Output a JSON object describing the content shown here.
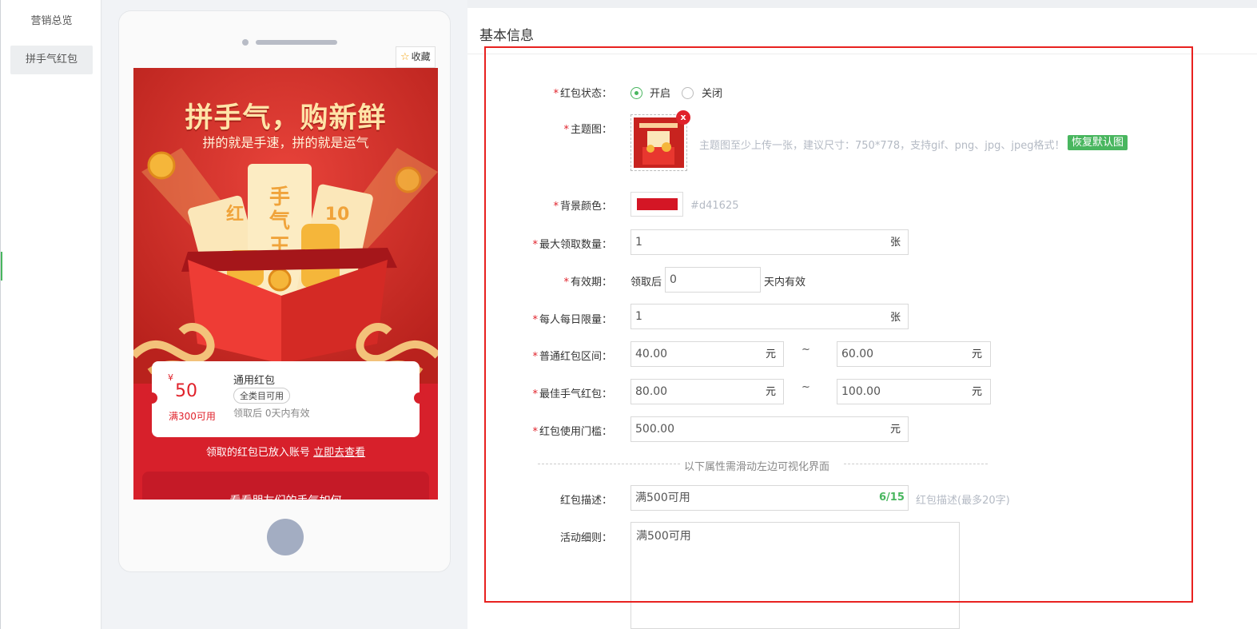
{
  "sidebar": {
    "items": [
      {
        "label": "营销总览"
      },
      {
        "label": "拼手气红包"
      }
    ]
  },
  "preview": {
    "favorite_label": "收藏",
    "hero_title": "拼手气，购新鲜",
    "hero_subtitle": "拼的就是手速，拼的就是运气",
    "coupon": {
      "currency": "¥",
      "amount": "50",
      "condition": "满300可用",
      "name": "通用红包",
      "tag": "全类目可用",
      "validity": "领取后 0天内有效"
    },
    "note": "领取的红包已放入账号",
    "note_link": "立即去查看",
    "friends_heading": "看看朋友们的手气如何"
  },
  "form": {
    "title": "基本信息",
    "status": {
      "label": "红包状态：",
      "option_on": "开启",
      "option_off": "关闭",
      "selected": "开启"
    },
    "theme_image": {
      "label": "主题图：",
      "hint": "主题图至少上传一张，建议尺寸：750*778，支持gif、png、jpg、jpeg格式！",
      "restore_label": "恢复默认图",
      "close_label": "x"
    },
    "bg_color": {
      "label": "背景颜色：",
      "value": "#d41625",
      "text": "#d41625"
    },
    "max_claim": {
      "label": "最大领取数量：",
      "value": "1",
      "unit": "张"
    },
    "validity": {
      "label": "有效期：",
      "prefix": "领取后",
      "value": "0",
      "suffix": "天内有效"
    },
    "daily_limit": {
      "label": "每人每日限量：",
      "value": "1",
      "unit": "张"
    },
    "normal_range": {
      "label": "普通红包区间：",
      "min": "40.00",
      "max": "60.00",
      "unit": "元",
      "sep": "~"
    },
    "best_range": {
      "label": "最佳手气红包：",
      "min": "80.00",
      "max": "100.00",
      "unit": "元",
      "sep": "~"
    },
    "threshold": {
      "label": "红包使用门槛：",
      "value": "500.00",
      "unit": "元"
    },
    "divider": "以下属性需滑动左边可视化界面",
    "description": {
      "label": "红包描述：",
      "value": "满500可用",
      "counter": "6/15",
      "hint": "红包描述(最多20字)"
    },
    "rules": {
      "label": "活动细则：",
      "value": "满500可用"
    },
    "required_mark": "*"
  }
}
